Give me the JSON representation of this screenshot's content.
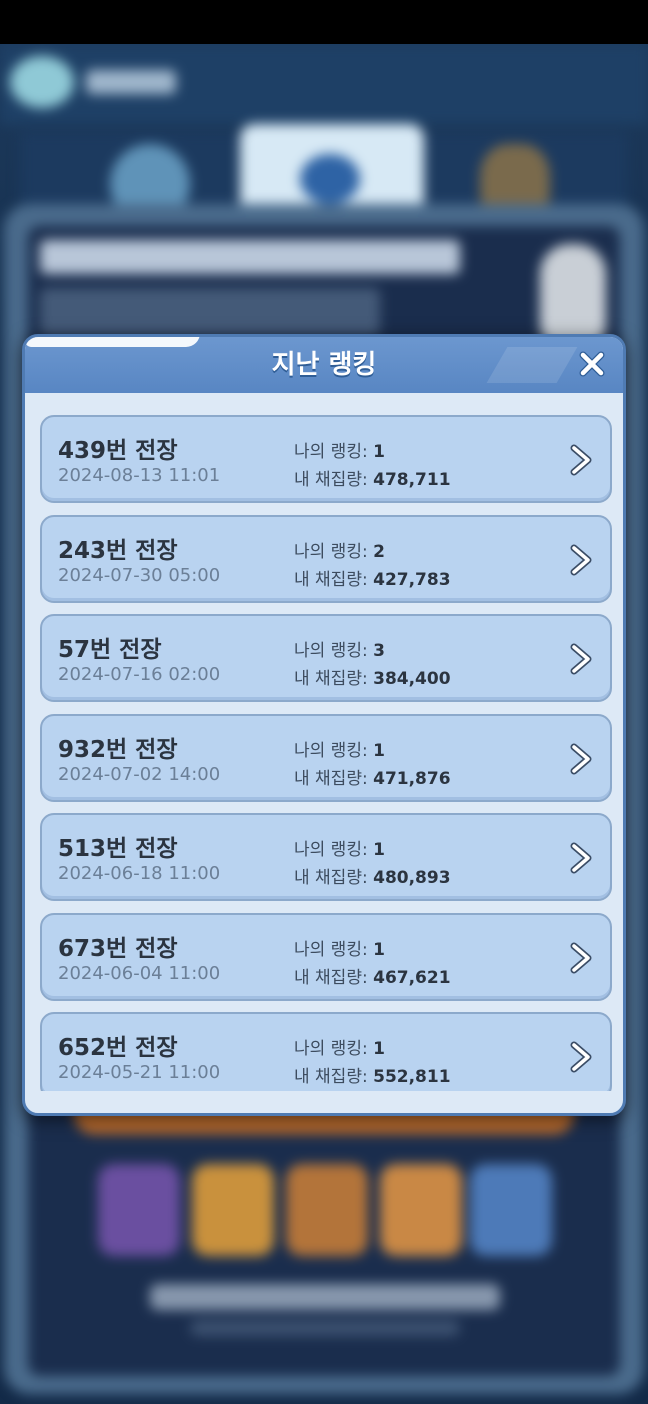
{
  "modal": {
    "title": "지난 랭킹",
    "close_icon": "close-icon",
    "rank_label": "나의 랭킹: ",
    "yield_label": "내 채집량: ",
    "battle_suffix": "번 전장",
    "colors": {
      "header": "#5f8ccb",
      "row": "#b9d3f0",
      "body": "#dde9f6"
    }
  },
  "rankings": [
    {
      "battle_no": "439",
      "date": "2024-08-13 11:01",
      "rank": "1",
      "yield": "478,711"
    },
    {
      "battle_no": "243",
      "date": "2024-07-30 05:00",
      "rank": "2",
      "yield": "427,783"
    },
    {
      "battle_no": "57",
      "date": "2024-07-16 02:00",
      "rank": "3",
      "yield": "384,400"
    },
    {
      "battle_no": "932",
      "date": "2024-07-02 14:00",
      "rank": "1",
      "yield": "471,876"
    },
    {
      "battle_no": "513",
      "date": "2024-06-18 11:00",
      "rank": "1",
      "yield": "480,893"
    },
    {
      "battle_no": "673",
      "date": "2024-06-04 11:00",
      "rank": "1",
      "yield": "467,621"
    },
    {
      "battle_no": "652",
      "date": "2024-05-21 11:00",
      "rank": "1",
      "yield": "552,811"
    }
  ]
}
